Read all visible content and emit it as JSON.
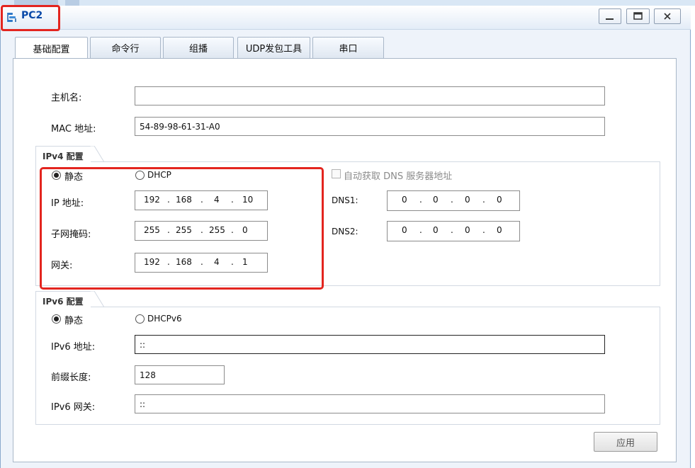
{
  "window": {
    "title": "PC2"
  },
  "tabs": [
    {
      "label": "基础配置"
    },
    {
      "label": "命令行"
    },
    {
      "label": "组播"
    },
    {
      "label": "UDP发包工具"
    },
    {
      "label": "串口"
    }
  ],
  "basic": {
    "hostname_label": "主机名:",
    "hostname_value": "",
    "mac_label": "MAC 地址:",
    "mac_value": "54-89-98-61-31-A0"
  },
  "ipv4": {
    "section_title": "IPv4 配置",
    "static_label": "静态",
    "dhcp_label": "DHCP",
    "mode": "static",
    "auto_dns_label": "自动获取 DNS 服务器地址",
    "ip_label": "IP 地址:",
    "ip_octets": [
      "192",
      "168",
      "4",
      "10"
    ],
    "mask_label": "子网掩码:",
    "mask_octets": [
      "255",
      "255",
      "255",
      "0"
    ],
    "gateway_label": "网关:",
    "gateway_octets": [
      "192",
      "168",
      "4",
      "1"
    ],
    "dns1_label": "DNS1:",
    "dns1_octets": [
      "0",
      "0",
      "0",
      "0"
    ],
    "dns2_label": "DNS2:",
    "dns2_octets": [
      "0",
      "0",
      "0",
      "0"
    ],
    "separator": "."
  },
  "ipv6": {
    "section_title": "IPv6 配置",
    "static_label": "静态",
    "dhcp_label": "DHCPv6",
    "mode": "static",
    "ip_label": "IPv6 地址:",
    "ip_value": "::",
    "prefix_label": "前缀长度:",
    "prefix_value": "128",
    "gateway_label": "IPv6 网关:",
    "gateway_value": "::"
  },
  "footer": {
    "apply_label": "应用"
  },
  "colors": {
    "accent": "#0b4aa8",
    "highlight": "#e3251f"
  },
  "icons": {
    "app": "network-pc-icon",
    "minimize": "minimize-icon",
    "maximize": "maximize-icon",
    "close": "close-icon"
  }
}
